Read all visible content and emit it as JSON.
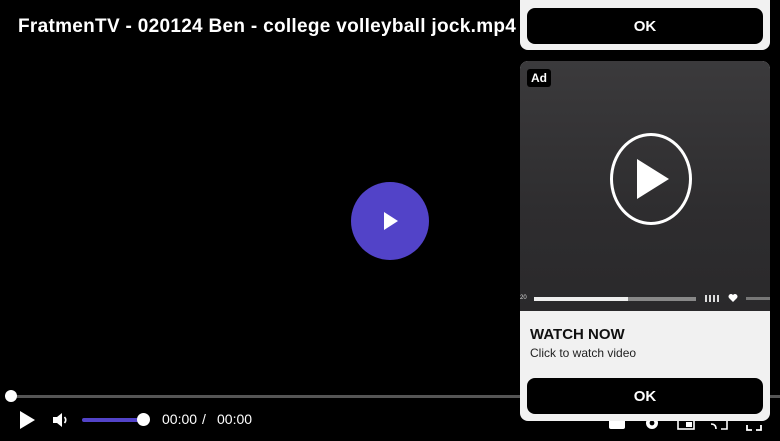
{
  "player": {
    "title": "FratmenTV - 020124 Ben - college volleyball jock.mp4",
    "current_time": "00:00",
    "separator": "/",
    "duration": "00:00",
    "progress": 0,
    "volume": 0.95,
    "accent_color": "#5243c8"
  },
  "ad": {
    "top_ok_label": "OK",
    "badge": "Ad",
    "thumb_time_label": "20",
    "headline": "WATCH NOW",
    "subtext": "Click to watch video",
    "ok_label": "OK"
  },
  "icons": {
    "big_play": "play-icon",
    "play": "play-icon",
    "volume": "volume-icon",
    "captions": "captions-icon",
    "settings": "gear-icon",
    "pip": "pip-icon",
    "cast": "cast-icon",
    "fullscreen": "fullscreen-icon"
  }
}
